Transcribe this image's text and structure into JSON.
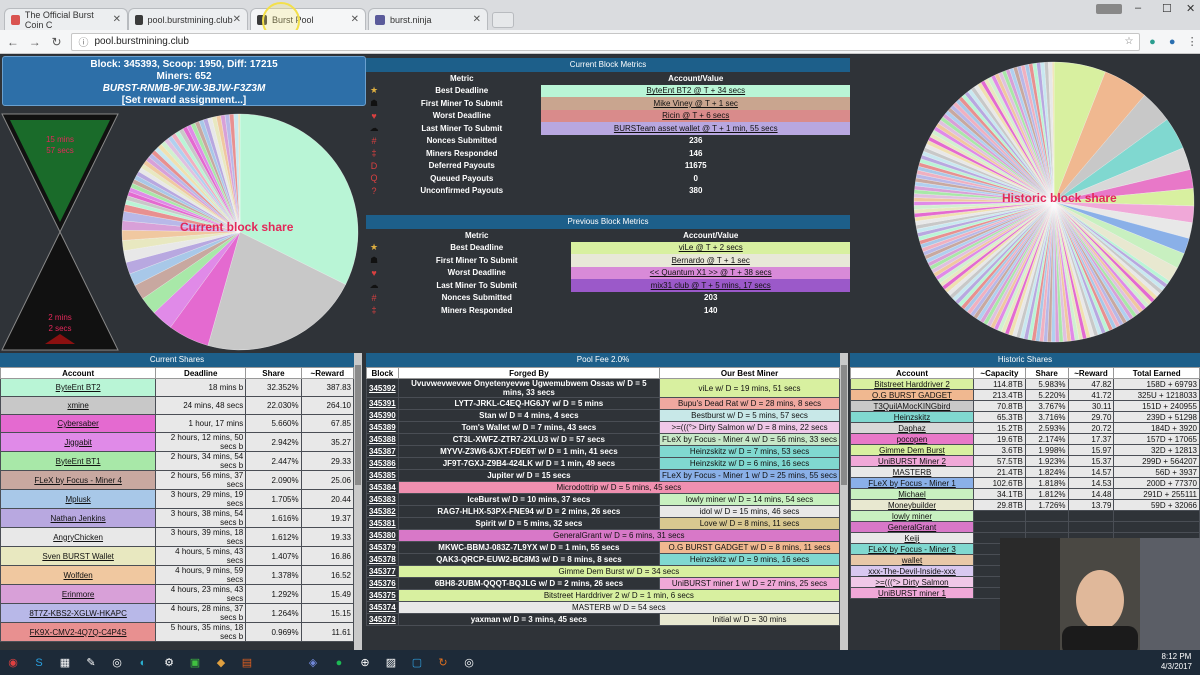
{
  "browser": {
    "tabs": [
      {
        "label": "The Official Burst Coin C",
        "color": "#d9534f"
      },
      {
        "label": "pool.burstmining.club",
        "color": "#3b3b3b"
      },
      {
        "label": "Burst Pool",
        "color": "#3b3b3b"
      },
      {
        "label": "burst.ninja",
        "color": "#5a5a9a"
      }
    ],
    "url": "pool.burstmining.club",
    "window_controls": [
      "–",
      "☐",
      "✕"
    ]
  },
  "block_info": {
    "line1": "Block: 345393, Scoop: 1950, Diff: 17215",
    "line2": "Miners: 652",
    "line3": "BURST-RNMB-9FJW-3BJW-F3Z3M",
    "line4": "[Set reward assignment...]"
  },
  "hourglass": {
    "top_text1": "15 mins",
    "top_text2": "57 secs",
    "bottom_text1": "2 mins",
    "bottom_text2": "2 secs",
    "progress": 0.12
  },
  "current_pie_label": "Current block share",
  "historic_pie_label": "Historic block share",
  "current_metrics": {
    "title": "Current Block Metrics",
    "col1": "Metric",
    "col2": "Account/Value",
    "rows": [
      {
        "icon": "★",
        "metric": "Best Deadline",
        "value": "ByteEnt BT2 @ T + 34 secs",
        "color": "#b9f5d6",
        "link": true
      },
      {
        "icon": "☗",
        "metric": "First Miner To Submit",
        "value": "Mike Viney @ T + 1 sec",
        "color": "#c9a58f",
        "link": true
      },
      {
        "icon": "♥",
        "metric": "Worst Deadline",
        "value": "Ricin @ T + 6 secs",
        "color": "#d98b8b",
        "link": true
      },
      {
        "icon": "☁",
        "metric": "Last Miner To Submit",
        "value": "BURSTeam asset wallet @ T + 1 min, 55 secs",
        "color": "#b8a7e0",
        "link": true
      },
      {
        "icon": "#",
        "metric": "Nonces Submitted",
        "value": "236",
        "color": "",
        "link": false
      },
      {
        "icon": "‡",
        "metric": "Miners Responded",
        "value": "146",
        "color": "",
        "link": false
      },
      {
        "icon": "D",
        "metric": "Deferred Payouts",
        "value": "11675",
        "color": "",
        "link": false
      },
      {
        "icon": "Q",
        "metric": "Queued Payouts",
        "value": "0",
        "color": "",
        "link": false
      },
      {
        "icon": "?",
        "metric": "Unconfirmed Payouts",
        "value": "380",
        "color": "",
        "link": false
      }
    ]
  },
  "previous_metrics": {
    "title": "Previous Block Metrics",
    "col1": "Metric",
    "col2": "Account/Value",
    "rows": [
      {
        "icon": "★",
        "metric": "Best Deadline",
        "value": "viLe @ T + 2 secs",
        "color": "#d8f0a0",
        "link": true
      },
      {
        "icon": "☗",
        "metric": "First Miner To Submit",
        "value": "Bernardo @ T + 1 sec",
        "color": "#e8e8d8",
        "link": true
      },
      {
        "icon": "♥",
        "metric": "Worst Deadline",
        "value": "<< Quantum X1 >> @ T + 38 secs",
        "color": "#d88ad8",
        "link": true
      },
      {
        "icon": "☁",
        "metric": "Last Miner To Submit",
        "value": "mix31 club @ T + 5 mins, 17 secs",
        "color": "#9b59c9",
        "link": true
      },
      {
        "icon": "#",
        "metric": "Nonces Submitted",
        "value": "203",
        "color": "",
        "link": false
      },
      {
        "icon": "‡",
        "metric": "Miners Responded",
        "value": "140",
        "color": "",
        "link": false
      }
    ]
  },
  "current_shares": {
    "title": "Current Shares",
    "headers": [
      "Account",
      "Deadline",
      "Share",
      "~Reward"
    ],
    "rows": [
      {
        "account": "ByteEnt BT2",
        "deadline": "18 mins b",
        "share": "32.352%",
        "reward": "387.83",
        "color": "#b9f5d6"
      },
      {
        "account": "xmine",
        "deadline": "24 mins, 48 secs",
        "share": "22.030%",
        "reward": "264.10",
        "color": "#c8c8c8"
      },
      {
        "account": "Cybersaber",
        "deadline": "1 hour, 17 mins",
        "share": "5.660%",
        "reward": "67.85",
        "color": "#e46ad0"
      },
      {
        "account": "Jiggabit",
        "deadline": "2 hours, 12 mins, 50 secs b",
        "share": "2.942%",
        "reward": "35.27",
        "color": "#e08ae8"
      },
      {
        "account": "ByteEnt BT1",
        "deadline": "2 hours, 34 mins, 54 secs b",
        "share": "2.447%",
        "reward": "29.33",
        "color": "#a8e8a8"
      },
      {
        "account": "FLeX by Focus - Miner 4",
        "deadline": "2 hours, 56 mins, 37 secs",
        "share": "2.090%",
        "reward": "25.06",
        "color": "#c8a8a0"
      },
      {
        "account": "Mplusk",
        "deadline": "3 hours, 29 mins, 19 secs",
        "share": "1.705%",
        "reward": "20.44",
        "color": "#a8c8e8"
      },
      {
        "account": "Nathan Jenkins",
        "deadline": "3 hours, 38 mins, 54 secs b",
        "share": "1.616%",
        "reward": "19.37",
        "color": "#b8a8e0"
      },
      {
        "account": "AngryChicken",
        "deadline": "3 hours, 39 mins, 18 secs",
        "share": "1.612%",
        "reward": "19.33",
        "color": "#e8e8e8"
      },
      {
        "account": "Sven BURST Wallet",
        "deadline": "4 hours, 5 mins, 43 secs",
        "share": "1.407%",
        "reward": "16.86",
        "color": "#e8e8c0"
      },
      {
        "account": "Wolfden",
        "deadline": "4 hours, 9 mins, 59 secs",
        "share": "1.378%",
        "reward": "16.52",
        "color": "#f0c8a0"
      },
      {
        "account": "Erinmore",
        "deadline": "4 hours, 23 mins, 43 secs",
        "share": "1.292%",
        "reward": "15.49",
        "color": "#d8a0d8"
      },
      {
        "account": "8T7Z-KBS2-XGLW-HKAPC",
        "deadline": "4 hours, 28 mins, 37 secs b",
        "share": "1.264%",
        "reward": "15.15",
        "color": "#b8b8e8"
      },
      {
        "account": "FK9X-CMV2-4Q7Q-C4P4S",
        "deadline": "5 hours, 35 mins, 18 secs b",
        "share": "0.969%",
        "reward": "11.61",
        "color": "#e89090"
      }
    ]
  },
  "pool_fee": {
    "title": "Pool Fee 2.0%",
    "headers": [
      "Block",
      "Forged By",
      "Our Best Miner"
    ],
    "rows": [
      {
        "block": "345392",
        "forged": "Uvuvwevwevwe Onyetenyevwe Ugwemubwem Ossas w/ D = 5 mins, 33 secs",
        "best": "viLe w/ D = 19 mins, 51 secs",
        "color": "#d8f0a0",
        "full": false
      },
      {
        "block": "345391",
        "forged": "LYT7-JRKL-C4EQ-HG6JY w/ D = 5 mins",
        "best": "Bupu's Dead Rat w/ D = 28 mins, 8 secs",
        "color": "#f0a8a0",
        "full": false
      },
      {
        "block": "345390",
        "forged": "Stan w/ D = 4 mins, 4 secs",
        "best": "Bestburst w/ D = 5 mins, 57 secs",
        "color": "#c8e8e8",
        "full": false
      },
      {
        "block": "345389",
        "forged": "Tom's Wallet w/ D = 7 mins, 43 secs",
        "best": ">=(((°> Dirty Salmon w/ D = 8 mins, 22 secs",
        "color": "#f0c8e8",
        "full": false
      },
      {
        "block": "345388",
        "forged": "CT3L-XWFZ-ZTR7-2XLU3 w/ D = 57 secs",
        "best": "FLeX by Focus - Miner 4 w/ D = 56 mins, 33 secs",
        "color": "#c8e8c8",
        "full": false
      },
      {
        "block": "345387",
        "forged": "MYVV-Z3W6-6JXT-FDE6T w/ D = 1 min, 41 secs",
        "best": "Heinzskitz w/ D = 7 mins, 53 secs",
        "color": "#80d8d0",
        "full": false
      },
      {
        "block": "345386",
        "forged": "JF9T-7GXJ-Z9B4-424LK w/ D = 1 min, 49 secs",
        "best": "Heinzskitz w/ D = 6 mins, 16 secs",
        "color": "#80d8d0",
        "full": false
      },
      {
        "block": "345385",
        "forged": "Jupiter w/ D = 15 secs",
        "best": "FLeX by Focus - Miner 1 w/ D = 25 mins, 55 secs",
        "color": "#8ab0e8",
        "full": false
      },
      {
        "block": "345384",
        "forged": "Microdottrip w/ D = 5 mins, 45 secs",
        "best": "",
        "color": "#f090b0",
        "full": true
      },
      {
        "block": "345383",
        "forged": "IceBurst w/ D = 10 mins, 37 secs",
        "best": "lowly miner w/ D = 14 mins, 54 secs",
        "color": "#c8f0c0",
        "full": false
      },
      {
        "block": "345382",
        "forged": "RAG7-HLHX-53PX-FNE94 w/ D = 2 mins, 26 secs",
        "best": "idol w/ D = 15 mins, 46 secs",
        "color": "#e8e8e8",
        "full": false
      },
      {
        "block": "345381",
        "forged": "Spirit w/ D = 5 mins, 32 secs",
        "best": "Love w/ D = 8 mins, 11 secs",
        "color": "#d8c890",
        "full": false
      },
      {
        "block": "345380",
        "forged": "GeneralGrant w/ D = 6 mins, 31 secs",
        "best": "",
        "color": "#d878c8",
        "full": true
      },
      {
        "block": "345379",
        "forged": "MKWC-BBMJ-083Z-7L9YX w/ D = 1 min, 55 secs",
        "best": "O.G BURST GADGET w/ D = 8 mins, 11 secs",
        "color": "#f0b890",
        "full": false
      },
      {
        "block": "345378",
        "forged": "QAK3-QRCP-EUW2-BC8M3 w/ D = 8 mins, 8 secs",
        "best": "Heinzskitz w/ D = 9 mins, 16 secs",
        "color": "#80d8d0",
        "full": false
      },
      {
        "block": "345377",
        "forged": "Gimme Dem Burst w/ D = 34 secs",
        "best": "",
        "color": "#d8f0a0",
        "full": true
      },
      {
        "block": "345376",
        "forged": "6BH8-2UBM-QQQT-BQJLG w/ D = 2 mins, 26 secs",
        "best": "UniBURST miner 1 w/ D = 27 mins, 25 secs",
        "color": "#f0a8d8",
        "full": false
      },
      {
        "block": "345375",
        "forged": "Bitstreet Harddriver 2 w/ D = 1 min, 6 secs",
        "best": "",
        "color": "#d8f0a0",
        "full": true
      },
      {
        "block": "345374",
        "forged": "MASTERB w/ D = 54 secs",
        "best": "",
        "color": "#e8e8e8",
        "full": true
      },
      {
        "block": "345373",
        "forged": "yaxman w/ D = 3 mins, 45 secs",
        "best": "Initial w/ D = 30 mins",
        "color": "#e8e8d0",
        "full": false
      }
    ]
  },
  "historic_shares": {
    "title": "Historic Shares",
    "headers": [
      "Account",
      "~Capacity",
      "Share",
      "~Reward",
      "Total Earned"
    ],
    "rows": [
      {
        "account": "Bitstreet Harddriver 2",
        "capacity": "114.8TB",
        "share": "5.983%",
        "reward": "47.82",
        "total": "158D + 69793",
        "color": "#d8f0a0"
      },
      {
        "account": "O.G BURST GADGET",
        "capacity": "213.4TB",
        "share": "5.220%",
        "reward": "41.72",
        "total": "325U + 1218033",
        "color": "#f0b890"
      },
      {
        "account": "T3QuilAMocKINGbird",
        "capacity": "70.8TB",
        "share": "3.767%",
        "reward": "30.11",
        "total": "151D + 240955",
        "color": "#c8c8c8"
      },
      {
        "account": "Heinzskitz",
        "capacity": "65.3TB",
        "share": "3.716%",
        "reward": "29.70",
        "total": "239D + 51298",
        "color": "#80d8d0"
      },
      {
        "account": "Daphaz",
        "capacity": "15.2TB",
        "share": "2.593%",
        "reward": "20.72",
        "total": "184D + 3920",
        "color": "#d8d8d8"
      },
      {
        "account": "pocopen",
        "capacity": "19.6TB",
        "share": "2.174%",
        "reward": "17.37",
        "total": "157D + 17065",
        "color": "#e878c8"
      },
      {
        "account": "Gimme Dem Burst",
        "capacity": "3.6TB",
        "share": "1.998%",
        "reward": "15.97",
        "total": "32D + 12813",
        "color": "#d8f0a0"
      },
      {
        "account": "UniBURST Miner 2",
        "capacity": "57.5TB",
        "share": "1.923%",
        "reward": "15.37",
        "total": "299D + 564207",
        "color": "#f0a8d8"
      },
      {
        "account": "MASTERB",
        "capacity": "21.4TB",
        "share": "1.824%",
        "reward": "14.57",
        "total": "56D + 3937",
        "color": "#e8e8e8"
      },
      {
        "account": "FLeX by Focus - Miner 1",
        "capacity": "102.6TB",
        "share": "1.818%",
        "reward": "14.53",
        "total": "200D + 77370",
        "color": "#8ab0e8"
      },
      {
        "account": "Michael",
        "capacity": "34.1TB",
        "share": "1.812%",
        "reward": "14.48",
        "total": "291D + 255111",
        "color": "#c8f0c0"
      },
      {
        "account": "Moneybuilder",
        "capacity": "29.8TB",
        "share": "1.726%",
        "reward": "13.79",
        "total": "59D + 32066",
        "color": "#e8e8d0"
      },
      {
        "account": "lowly miner",
        "capacity": "",
        "share": "",
        "reward": "",
        "total": "",
        "color": "#c8f0c0"
      },
      {
        "account": "GeneralGrant",
        "capacity": "",
        "share": "",
        "reward": "",
        "total": "",
        "color": "#d878c8"
      },
      {
        "account": "Keiji",
        "capacity": "",
        "share": "",
        "reward": "",
        "total": "",
        "color": "#e8e8e8"
      },
      {
        "account": "FLeX by Focus - Miner 3",
        "capacity": "",
        "share": "",
        "reward": "",
        "total": "",
        "color": "#80d8d0"
      },
      {
        "account": "wallet",
        "capacity": "",
        "share": "",
        "reward": "",
        "total": "",
        "color": "#e8c8a8"
      },
      {
        "account": "xxx-The-Devil-Inside-xxx",
        "capacity": "",
        "share": "",
        "reward": "",
        "total": "",
        "color": "#d8c8f0"
      },
      {
        "account": ">=(((°> Dirty Salmon",
        "capacity": "",
        "share": "",
        "reward": "",
        "total": "",
        "color": "#f0c8e8"
      },
      {
        "account": "UniBURST miner 1",
        "capacity": "",
        "share": "",
        "reward": "",
        "total": "",
        "color": "#f0a8d8"
      }
    ]
  },
  "current_pie_slices": [
    {
      "value": 32.352,
      "color": "#b9f5d6"
    },
    {
      "value": 22.03,
      "color": "#c8c8c8"
    },
    {
      "value": 5.66,
      "color": "#e46ad0"
    },
    {
      "value": 2.942,
      "color": "#e08ae8"
    },
    {
      "value": 2.447,
      "color": "#a8e8a8"
    },
    {
      "value": 2.09,
      "color": "#c8a8a0"
    },
    {
      "value": 1.705,
      "color": "#a8c8e8"
    },
    {
      "value": 1.616,
      "color": "#b8a8e0"
    },
    {
      "value": 1.612,
      "color": "#e8e8e8"
    },
    {
      "value": 1.407,
      "color": "#e8e8c0"
    },
    {
      "value": 1.378,
      "color": "#f0c8a0"
    },
    {
      "value": 1.292,
      "color": "#d8a0d8"
    },
    {
      "value": 1.264,
      "color": "#b8b8e8"
    },
    {
      "value": 0.969,
      "color": "#e89090"
    }
  ],
  "taskbar": {
    "time": "8:12 PM",
    "date": "4/3/2017",
    "icons": [
      "windows-start",
      "skype",
      "calculator",
      "paint",
      "chrome-alt",
      "media",
      "wordpad",
      "tools",
      "app",
      "explorer",
      "discord",
      "spotify",
      "app2",
      "photos",
      "app3",
      "app4",
      "obs"
    ]
  }
}
